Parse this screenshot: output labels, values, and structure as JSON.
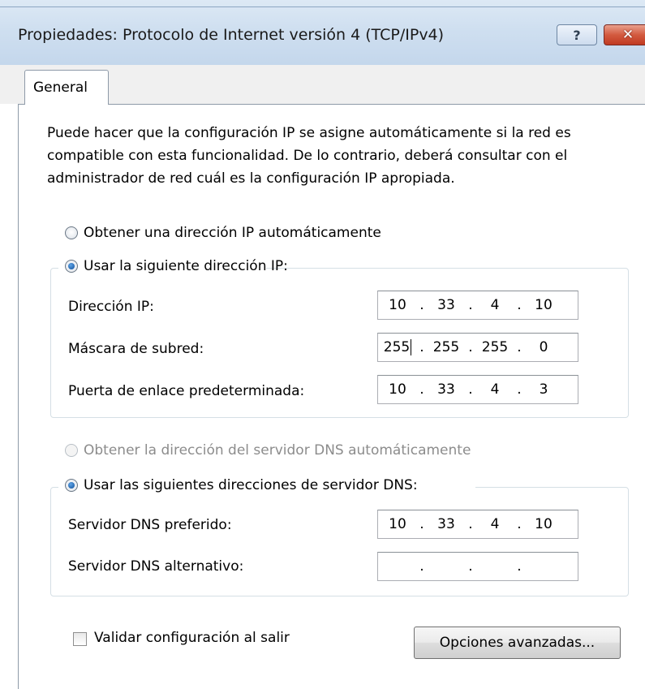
{
  "window": {
    "title": "Propiedades: Protocolo de Internet versión 4 (TCP/IPv4)",
    "help_glyph": "?",
    "close_glyph": "✕"
  },
  "tabs": [
    {
      "label": "General"
    }
  ],
  "intro_text": "Puede hacer que la configuración IP se asigne automáticamente si la red es compatible con esta funcionalidad. De lo contrario, deberá consultar con el administrador de red cuál es la configuración IP apropiada.",
  "ip_options": {
    "auto_label": "Obtener una dirección IP automáticamente",
    "manual_label": "Usar la siguiente dirección IP:",
    "selected": "manual"
  },
  "ip_fields": [
    {
      "label": "Dirección IP:",
      "octets": [
        "10",
        "33",
        "4",
        "10"
      ]
    },
    {
      "label": "Máscara de subred:",
      "octets": [
        "255",
        "255",
        "255",
        "0"
      ]
    },
    {
      "label": "Puerta de enlace predeterminada:",
      "octets": [
        "10",
        "33",
        "4",
        "3"
      ]
    }
  ],
  "dns_options": {
    "auto_label": "Obtener la dirección del servidor DNS automáticamente",
    "manual_label": "Usar las siguientes direcciones de servidor DNS:",
    "selected": "manual",
    "auto_disabled": true
  },
  "dns_fields": [
    {
      "label": "Servidor DNS preferido:",
      "octets": [
        "10",
        "33",
        "4",
        "10"
      ]
    },
    {
      "label": "Servidor DNS alternativo:",
      "octets": [
        "",
        "",
        "",
        ""
      ]
    }
  ],
  "ip_separator": ".",
  "validate_label": "Validar configuración al salir",
  "validate_checked": false,
  "advanced_button": "Opciones avanzadas...",
  "colors": {
    "titlebar": "#cfdff0",
    "close_button": "#c03a22",
    "radio_selected": "#1d5ea8"
  }
}
